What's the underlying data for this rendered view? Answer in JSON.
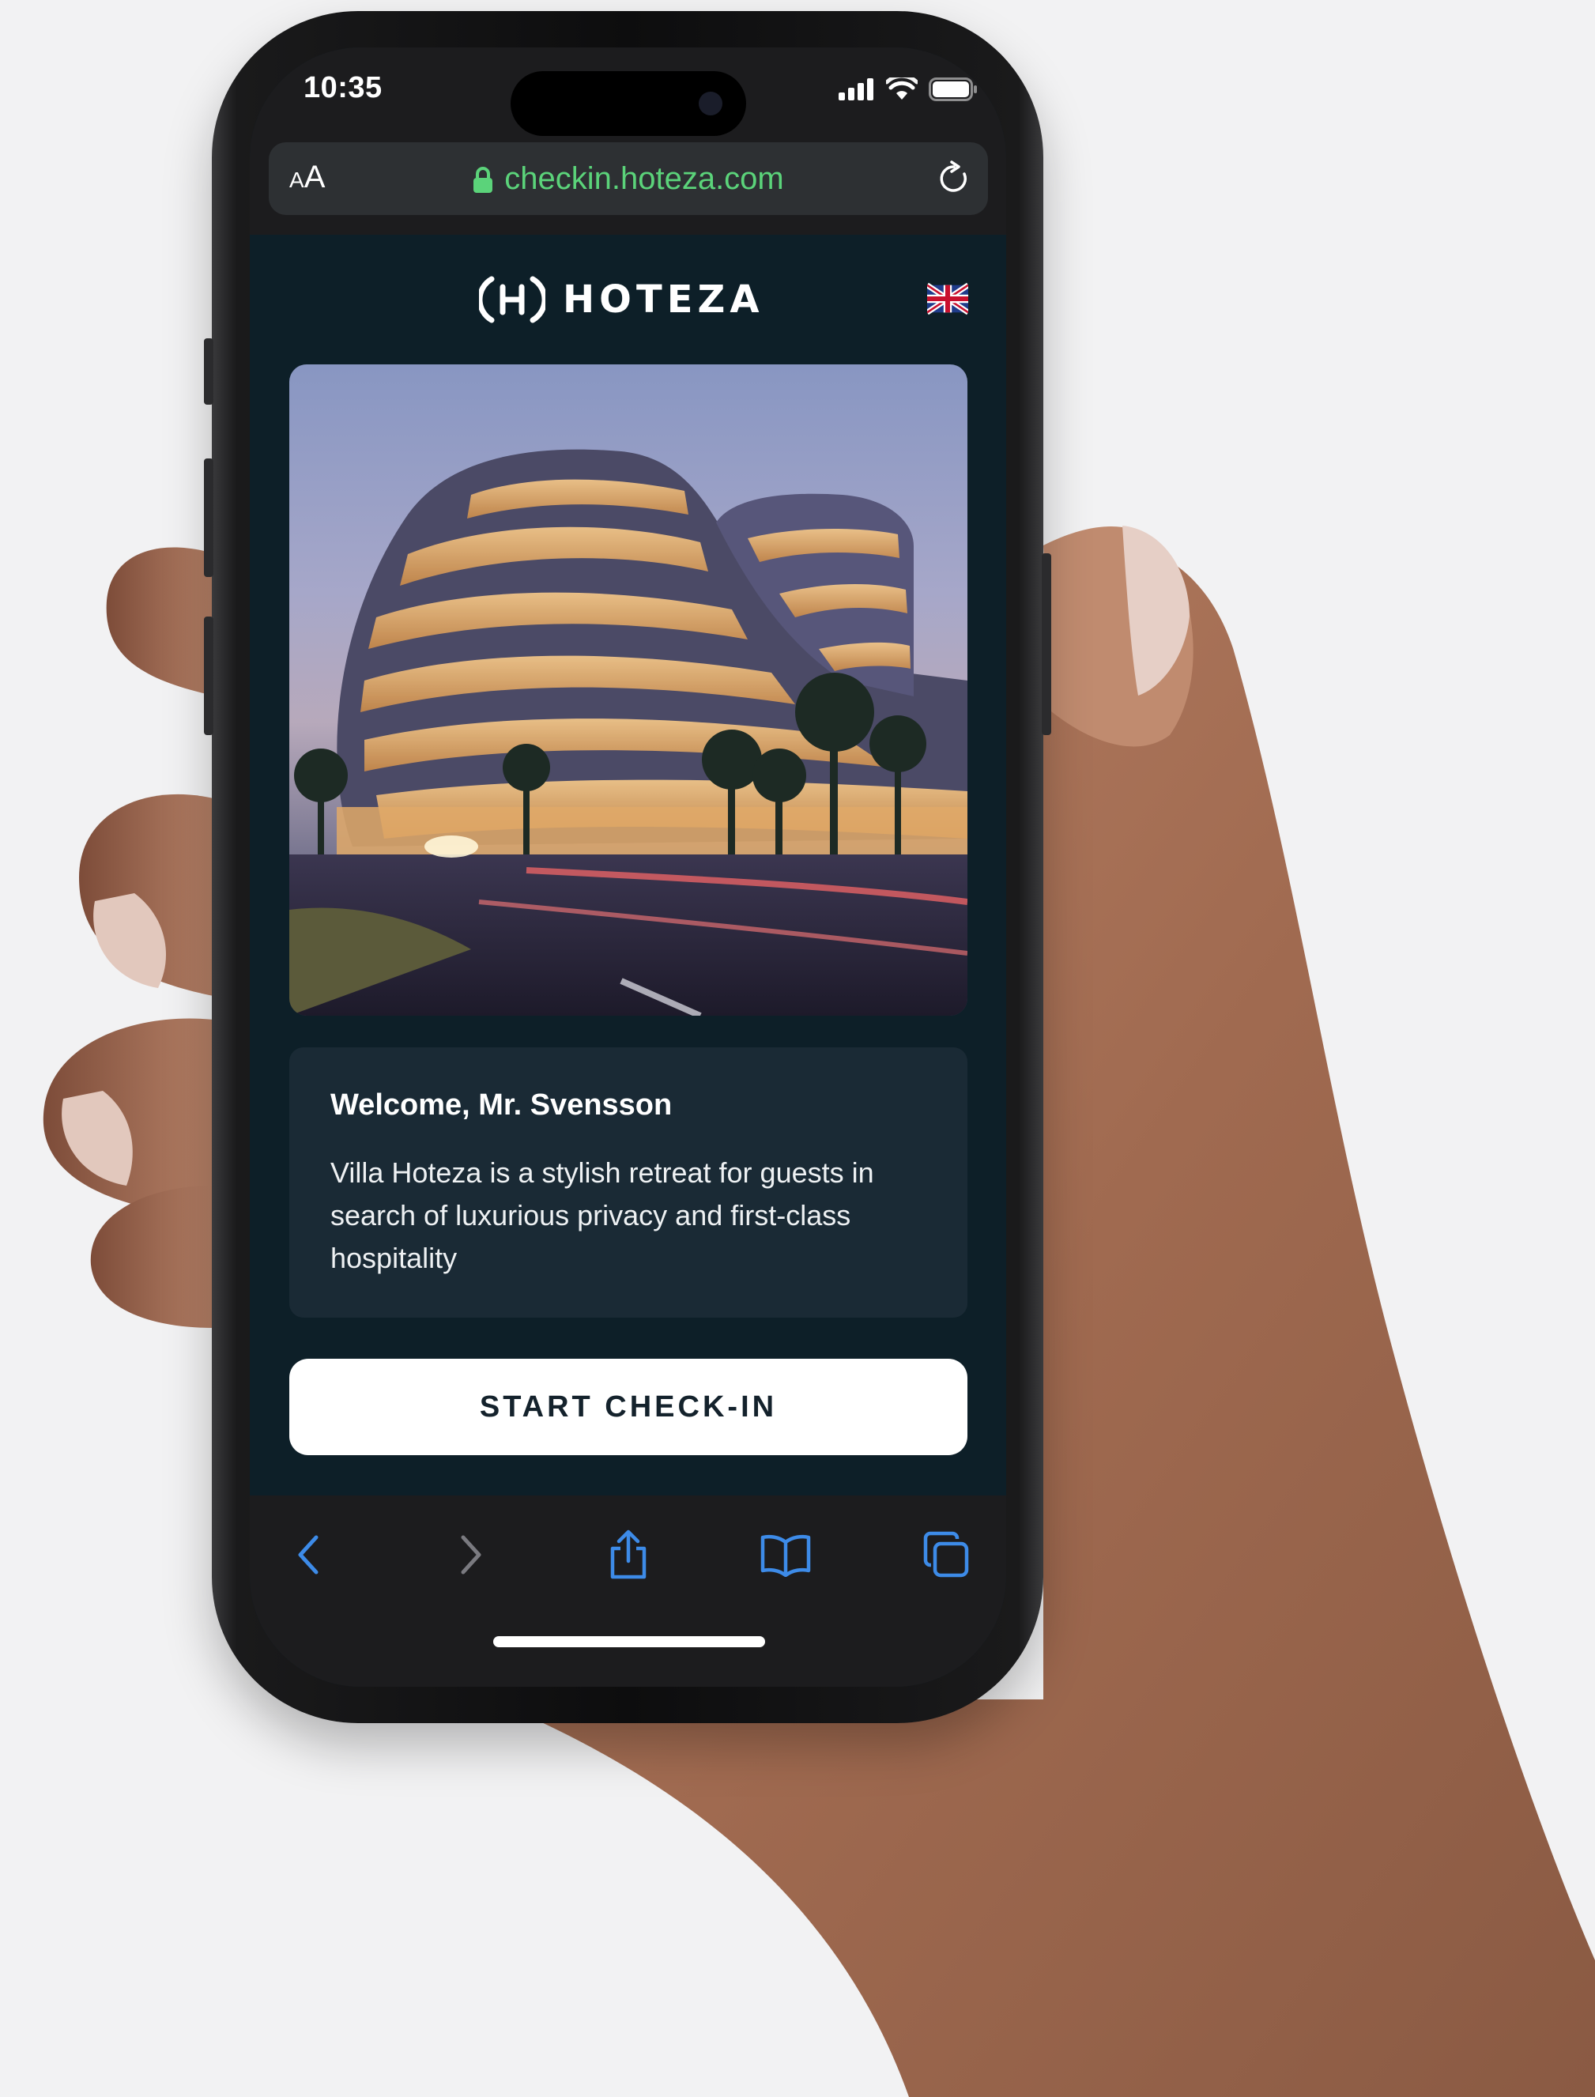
{
  "status_bar": {
    "time": "10:35"
  },
  "browser": {
    "text_size_label_small": "A",
    "text_size_label_large": "A",
    "url": "checkin.hoteza.com",
    "url_color": "#5bd37a"
  },
  "header": {
    "brand": "HOTEZA",
    "language_flag": "uk-flag-icon"
  },
  "welcome_card": {
    "title": "Welcome, Mr. Svensson",
    "body": "Villa Hoteza is a stylish retreat for guests in search of luxurious privacy and first-class hospitality"
  },
  "cta": {
    "label": "START CHECK-IN"
  },
  "toolbar": {
    "icons": [
      "back-icon",
      "forward-icon",
      "share-icon",
      "bookmarks-icon",
      "tabs-icon"
    ],
    "accent": "#3d8be8"
  },
  "colors": {
    "page_background": "#0d1f28",
    "card": "#1a2a35",
    "button": "#ffffff"
  }
}
